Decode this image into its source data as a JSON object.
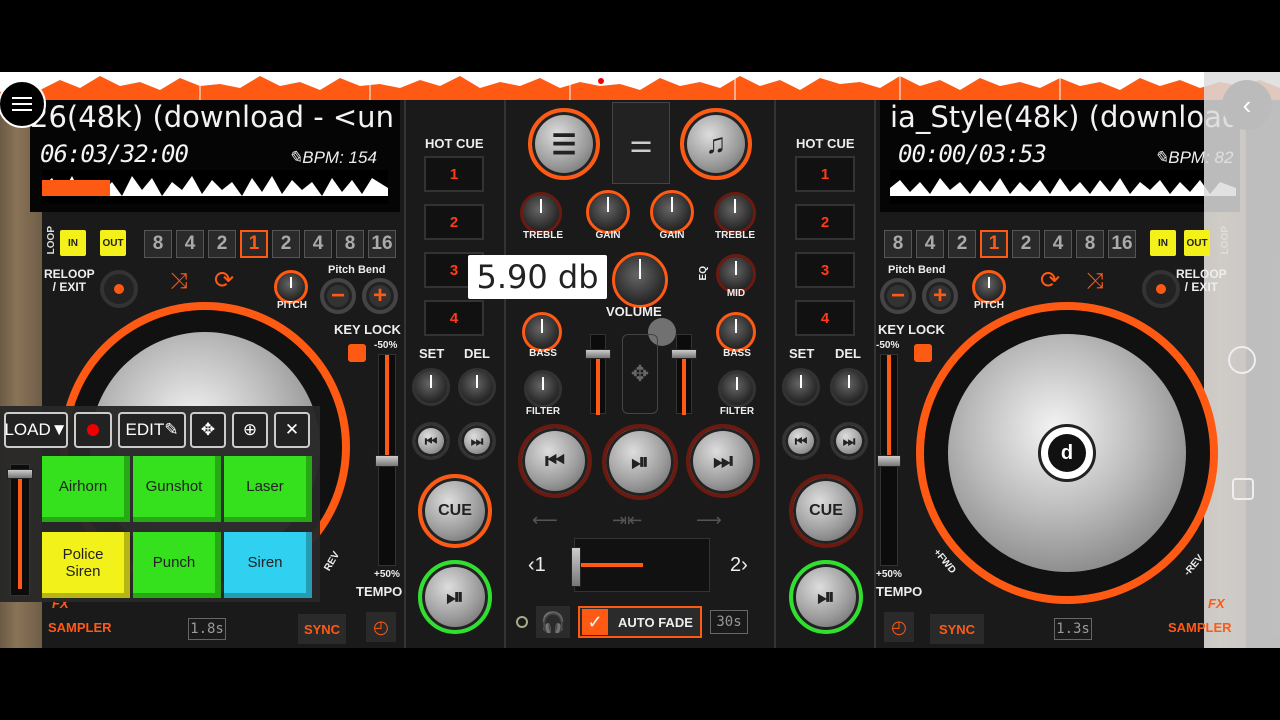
{
  "top": {
    "rec_label": "REC"
  },
  "left_deck": {
    "track_title": "26(48k) (download - <un",
    "time": "06:03/32:00",
    "bpm": "BPM: 154",
    "loop_label": "LOOP",
    "loop_in": "IN",
    "loop_out": "OUT",
    "loop_sizes": [
      "8",
      "4",
      "2",
      "1",
      "2",
      "4",
      "8",
      "16"
    ],
    "active_loop_index": 3,
    "reloop_label": "RELOOP\n/ EXIT",
    "pitch_bend_label": "Pitch Bend",
    "pitch_label": "PITCH",
    "key_lock_label": "KEY LOCK",
    "pitch_range_top": "-50%",
    "pitch_range_bottom": "+50%",
    "tempo_label": "TEMPO",
    "sync_label": "SYNC",
    "sampler_label": "SAMPLER",
    "fx_label": "FX",
    "rev_label": "REV",
    "bar_length": "1.8s",
    "hot_cue_label": "HOT CUE",
    "hot_cues": [
      "1",
      "2",
      "3",
      "4"
    ],
    "set_label": "SET",
    "del_label": "DEL",
    "cue_label": "CUE"
  },
  "right_deck": {
    "track_title": "ia_Style(48k) (download",
    "time": "00:00/03:53",
    "bpm": "BPM: 82",
    "loop_label": "LOOP",
    "loop_in": "IN",
    "loop_out": "OUT",
    "loop_sizes": [
      "8",
      "4",
      "2",
      "1",
      "2",
      "4",
      "8",
      "16"
    ],
    "active_loop_index": 3,
    "reloop_label": "RELOOP\n/ EXIT",
    "pitch_bend_label": "Pitch Bend",
    "pitch_label": "PITCH",
    "key_lock_label": "KEY LOCK",
    "pitch_range_top": "-50%",
    "pitch_range_bottom": "+50%",
    "tempo_label": "TEMPO",
    "sync_label": "SYNC",
    "sampler_label": "SAMPLER",
    "fx_label": "FX",
    "fwd_label": "+FWD",
    "rev_label": "-REV",
    "bar_length": "1.3s",
    "hot_cue_label": "HOT CUE",
    "hot_cues": [
      "1",
      "2",
      "3",
      "4"
    ],
    "set_label": "SET",
    "del_label": "DEL",
    "cue_label": "CUE"
  },
  "mixer": {
    "treble_label": "TREBLE",
    "gain_label": "GAIN",
    "bass_label": "BASS",
    "mid_label": "MID",
    "filter_label": "FILTER",
    "eq_label": "EQ",
    "volume_label": "VOLUME",
    "volume_popup": "5.90 db",
    "crossfader_left": "‹1",
    "crossfader_right": "2›",
    "auto_fade_label": "AUTO FADE",
    "auto_fade_time": "30s"
  },
  "sampler": {
    "load_label": "LOAD▼",
    "edit_label": "EDIT",
    "pads": [
      {
        "label": "Airhorn",
        "color": "#35e01c"
      },
      {
        "label": "Gunshot",
        "color": "#35e01c"
      },
      {
        "label": "Laser",
        "color": "#35e01c"
      },
      {
        "label": "Police\nSiren",
        "color": "#f2f21a"
      },
      {
        "label": "Punch",
        "color": "#35e01c"
      },
      {
        "label": "Siren",
        "color": "#2fd0f0"
      }
    ]
  },
  "colors": {
    "accent": "#ff5a14",
    "green": "#2fe02f",
    "yellow": "#f4f01a"
  }
}
